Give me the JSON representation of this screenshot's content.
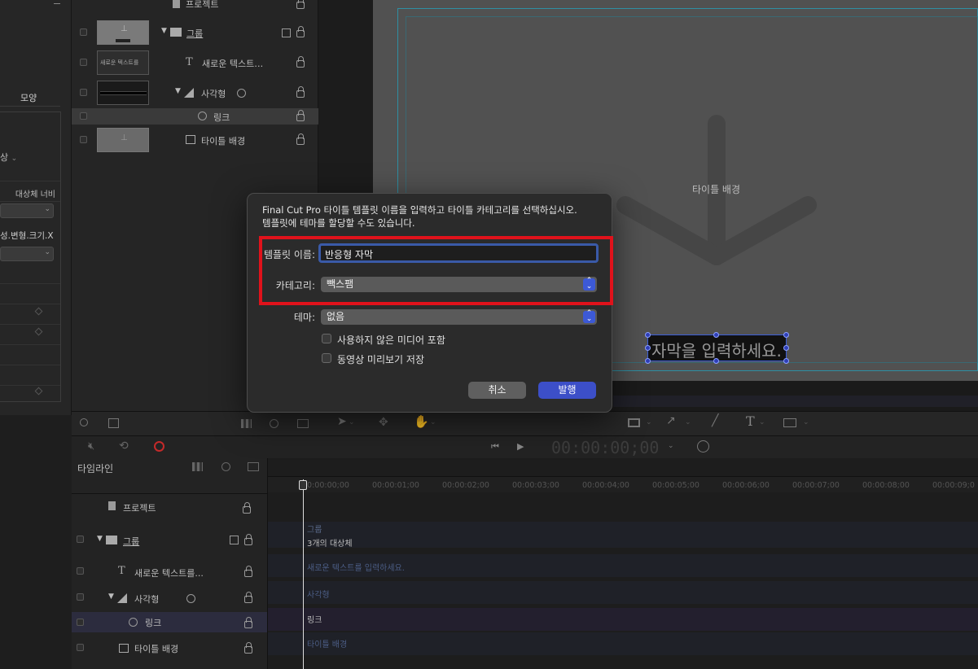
{
  "inspector": {
    "tab_label": "모양",
    "dropdown1": "상",
    "header_label": "대상체 너비",
    "dropdown2": "성.변형.크기.X"
  },
  "layers": {
    "rows": [
      {
        "label": "프로젝트"
      },
      {
        "label": "그룹"
      },
      {
        "label": "새로운 텍스트…",
        "thumb_text": "새로운 텍스트를"
      },
      {
        "label": "사각형"
      },
      {
        "label": "링크"
      },
      {
        "label": "타이틀 배경"
      }
    ]
  },
  "canvas": {
    "title_bg_label": "타이틀 배경",
    "subtitle_text": "자막을 입력하세요."
  },
  "dialog": {
    "message": "Final Cut Pro 타이틀 템플릿 이름을 입력하고 타이틀 카테고리를 선택하십시오. 템플릿에 테마를 할당할 수도 있습니다.",
    "message_line1": "Final Cut Pro 타이틀 템플릿 이름을 입력하고 타이틀 카테고리를 선택하십시오.",
    "message_line2": "템플릿에 테마를 할당할 수도 있습니다.",
    "template_name_label": "템플릿 이름:",
    "template_name_value": "반응형 자막",
    "category_label": "카테고리:",
    "category_value": "빽스팸",
    "theme_label": "테마:",
    "theme_value": "없음",
    "checkbox_unused_media": "사용하지 않은 미디어 포함",
    "checkbox_save_preview": "동영상 미리보기 저장",
    "cancel_label": "취소",
    "publish_label": "발행",
    "accent_color": "#3c59d6",
    "highlight_color": "#e0121b"
  },
  "transport": {
    "timecode": "00:00:00;00"
  },
  "timeline": {
    "title": "타임라인",
    "layers": [
      {
        "label": "프로젝트"
      },
      {
        "label": "그룹"
      },
      {
        "label": "새로운 텍스트를..."
      },
      {
        "label": "사각형"
      },
      {
        "label": "링크"
      },
      {
        "label": "타이틀 배경"
      }
    ],
    "ruler": [
      "00:00:00;00",
      "00:00:01;00",
      "00:00:02;00",
      "00:00:03;00",
      "00:00:04;00",
      "00:00:05;00",
      "00:00:06;00",
      "00:00:07;00",
      "00:00:08;00",
      "00:00:09;0"
    ],
    "tracks": [
      {
        "label": "그룹",
        "sub": "3개의 대상체"
      },
      {
        "label": "새로운 텍스트를 입력하세요."
      },
      {
        "label": "사각형"
      },
      {
        "label": "링크"
      },
      {
        "label": "타이틀 배경"
      }
    ]
  }
}
